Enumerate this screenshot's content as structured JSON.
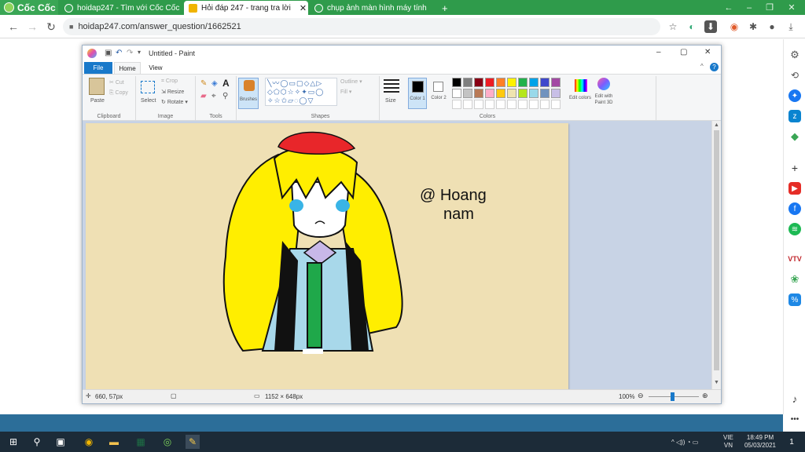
{
  "browser": {
    "brand": "Cốc Cốc",
    "tabs": [
      {
        "title": "hoidap247 - Tìm với Cốc Cốc",
        "fav_color": "#3aa655",
        "active": false
      },
      {
        "title": "Hỏi đáp 247 - trang tra lời",
        "fav_color": "#f0b400",
        "active": true
      },
      {
        "title": "chụp ảnh màn hình máy tính",
        "fav_color": "#3aa655",
        "active": false
      }
    ],
    "url": "hoidap247.com/answer_question/1662521",
    "window_controls": [
      "–",
      "❐",
      "✕"
    ]
  },
  "paint": {
    "title": "Untitled - Paint",
    "menu": {
      "file": "File",
      "home": "Home",
      "view": "View"
    },
    "clipboard": {
      "paste": "Paste",
      "cut": "Cut",
      "copy": "Copy",
      "label": "Clipboard"
    },
    "image": {
      "select": "Select",
      "crop": "Crop",
      "resize": "Resize",
      "rotate": "Rotate ▾",
      "label": "Image"
    },
    "tools": {
      "label": "Tools",
      "brushes": "Brushes"
    },
    "shapes": {
      "label": "Shapes",
      "outline": "Outline ▾",
      "fill": "Fill ▾"
    },
    "size": "Size",
    "color1": "Color 1",
    "color2": "Color 2",
    "colors_label": "Colors",
    "edit_colors": "Edit colors",
    "edit_3d": "Edit with Paint 3D",
    "palette_row1": [
      "#000000",
      "#7f7f7f",
      "#880015",
      "#ed1c24",
      "#ff7f27",
      "#fff200",
      "#22b14c",
      "#00a2e8",
      "#3f48cc",
      "#a349a4"
    ],
    "palette_row2": [
      "#ffffff",
      "#c3c3c3",
      "#b97a57",
      "#ffaec9",
      "#ffc90e",
      "#efe4b0",
      "#b5e61d",
      "#99d9ea",
      "#7092be",
      "#c8bfe7"
    ],
    "canvas_text_1": "@ Hoang",
    "canvas_text_2": "nam",
    "status": {
      "position": "660, 57px",
      "size": "1152 × 648px",
      "zoom": "100%"
    }
  },
  "taskbar": {
    "lang_1": "VIE",
    "lang_2": "VN",
    "time": "18:49 PM",
    "date": "05/03/2021",
    "notif": "1"
  }
}
